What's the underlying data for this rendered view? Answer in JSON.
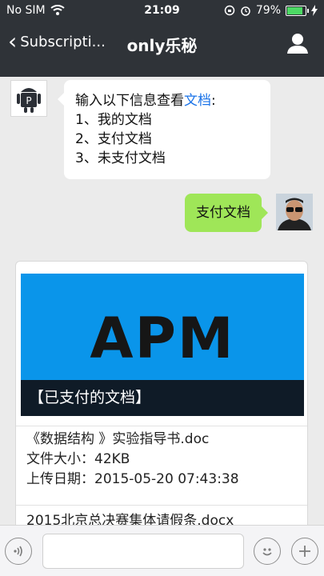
{
  "status": {
    "carrier": "No SIM",
    "time": "21:09",
    "battery": "79%"
  },
  "nav": {
    "back_label": "Subscripti...",
    "title": "only乐秘"
  },
  "messages": {
    "bot_prefix": "输入以下信息查看",
    "bot_link": "文档",
    "bot_suffix": ":",
    "bot_options": [
      "1、我的文档",
      "2、支付文档",
      "3、未支付文档"
    ],
    "user_text": "支付文档"
  },
  "card": {
    "banner_text": "APM",
    "banner_caption": "【已支付的文档】",
    "item1_title": "《数据结构 》实验指导书.doc",
    "item1_size": "文件大小：42KB",
    "item1_date": "上传日期：2015-05-20 07:43:38",
    "item2_title": "2015北京总决赛集体请假条.docx"
  },
  "input": {
    "placeholder": ""
  },
  "icons": {
    "back": "chevron-left-icon",
    "user": "user-icon",
    "voice": "voice-icon",
    "emoji": "emoji-icon",
    "plus": "plus-icon"
  },
  "colors": {
    "nav_bg": "#2f3338",
    "user_bubble": "#9fe658",
    "banner_bg": "#0a95ea",
    "link": "#1a73e8"
  }
}
